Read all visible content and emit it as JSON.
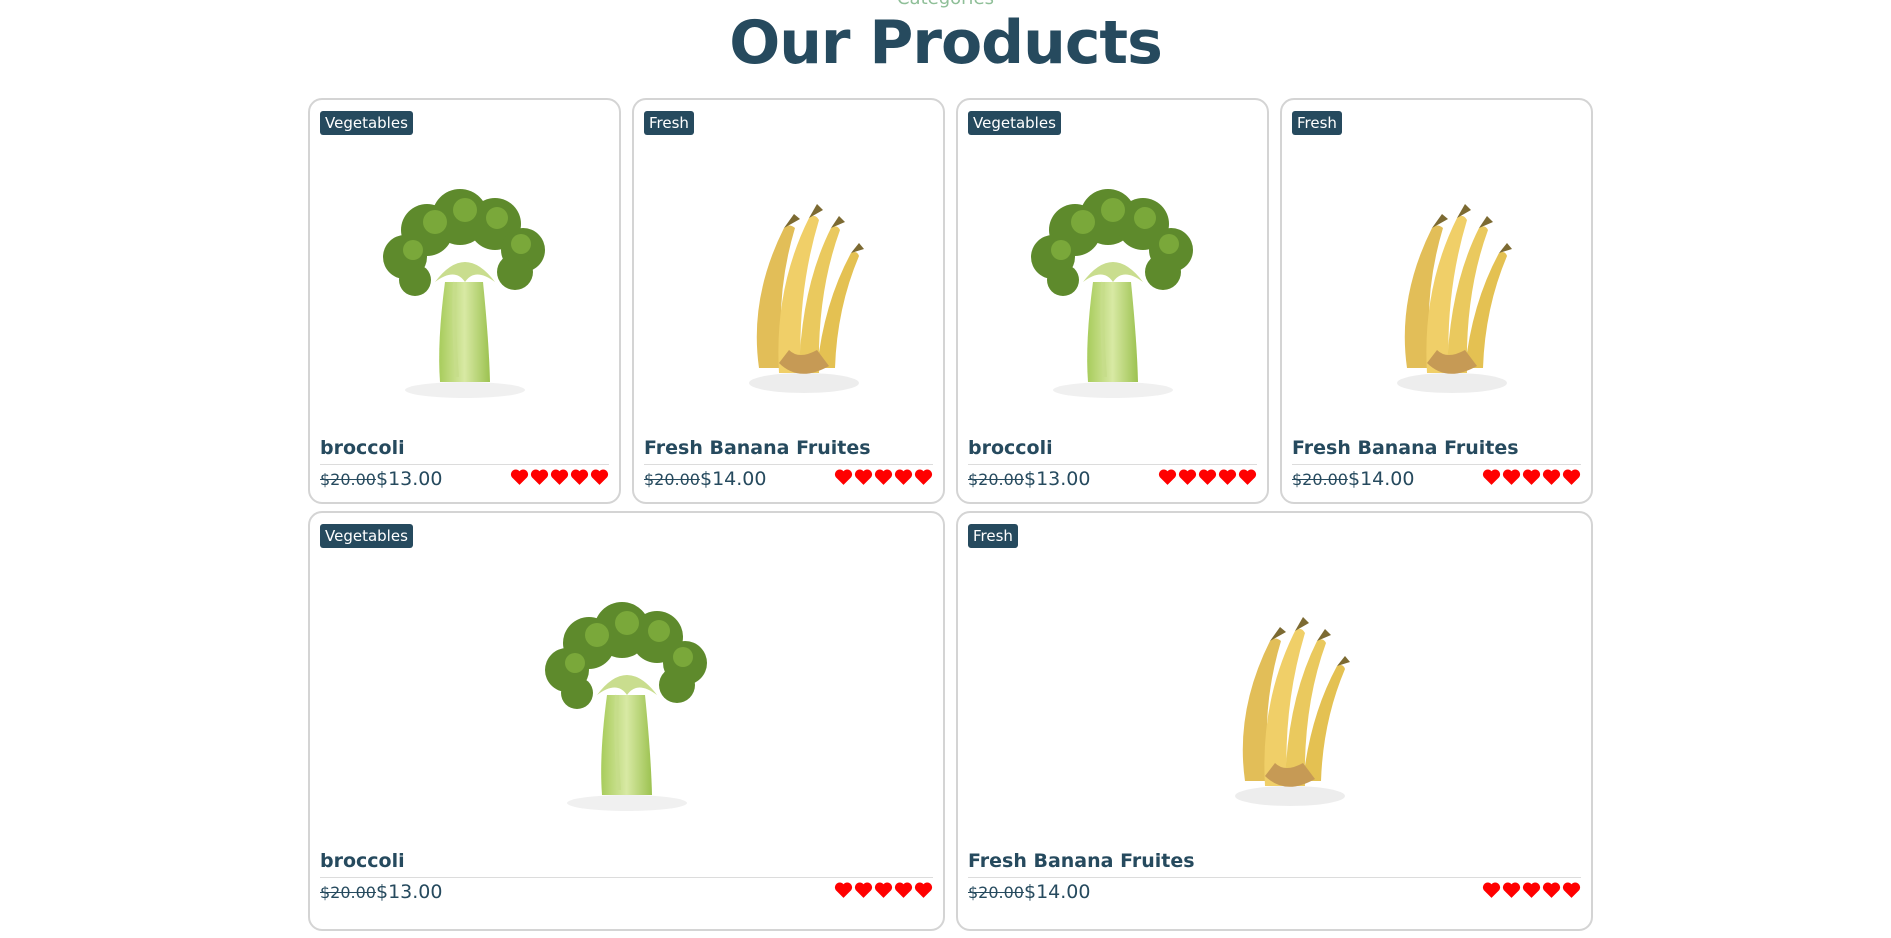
{
  "header": {
    "eyebrow": "Categories",
    "title": "Our Products"
  },
  "colors": {
    "primary": "#264a5e",
    "accent": "#8fbf98",
    "star": "#ff0000",
    "border": "#d4d4d4"
  },
  "products": [
    {
      "badge": "Vegetables",
      "name": "broccoli",
      "old_price": "$20.00",
      "price": "$13.00",
      "rating": 5,
      "image": "broccoli-image"
    },
    {
      "badge": "Fresh",
      "name": "Fresh Banana Fruites",
      "old_price": "$20.00",
      "price": "$14.00",
      "rating": 5,
      "image": "banana-image"
    },
    {
      "badge": "Vegetables",
      "name": "broccoli",
      "old_price": "$20.00",
      "price": "$13.00",
      "rating": 5,
      "image": "broccoli-image"
    },
    {
      "badge": "Fresh",
      "name": "Fresh Banana Fruites",
      "old_price": "$20.00",
      "price": "$14.00",
      "rating": 5,
      "image": "banana-image"
    },
    {
      "badge": "Vegetables",
      "name": "broccoli",
      "old_price": "$20.00",
      "price": "$13.00",
      "rating": 5,
      "image": "broccoli-image"
    },
    {
      "badge": "Fresh",
      "name": "Fresh Banana Fruites",
      "old_price": "$20.00",
      "price": "$14.00",
      "rating": 5,
      "image": "banana-image"
    }
  ]
}
